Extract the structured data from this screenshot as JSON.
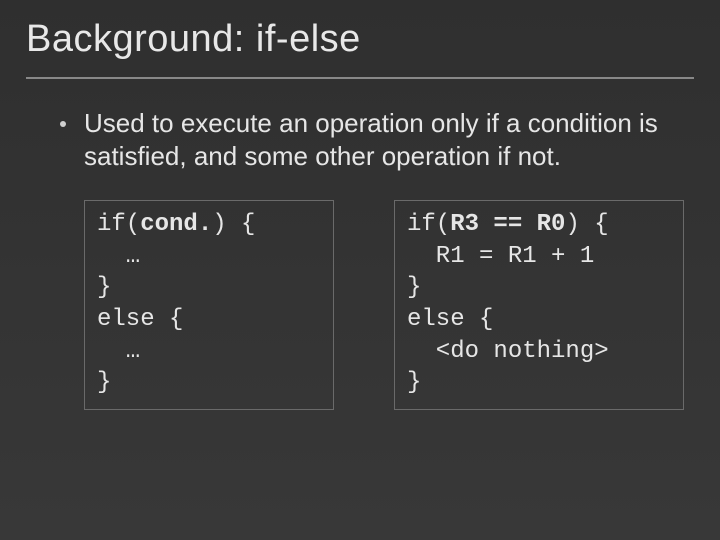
{
  "slide": {
    "title": "Background: if-else",
    "bullet": "Used to execute an operation only if a condition is satisfied, and some other operation if not.",
    "code_left": {
      "l1a": "if(",
      "l1b": "cond.",
      "l1c": ") {",
      "l2": "  …",
      "l3": "}",
      "l4": "else {",
      "l5": "  …",
      "l6": "}"
    },
    "code_right": {
      "l1a": "if(",
      "l1b": "R3 == R0",
      "l1c": ") {",
      "l2": "  R1 = R1 + 1",
      "l3": "}",
      "l4": "else {",
      "l5": "  <do nothing>",
      "l6": "}"
    }
  }
}
